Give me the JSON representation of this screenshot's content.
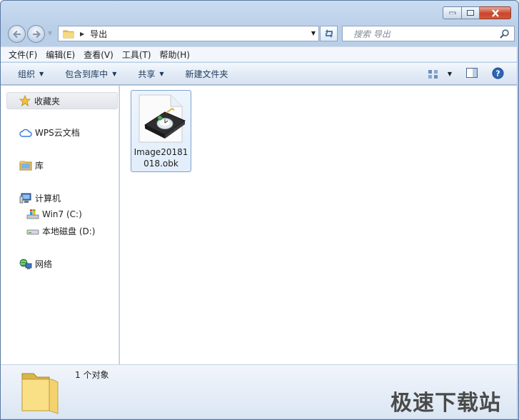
{
  "titlebar": {
    "minimize_icon": "minimize-icon",
    "maximize_icon": "maximize-icon",
    "close_icon": "close-icon"
  },
  "address_bar": {
    "breadcrumb": [
      "导出"
    ],
    "search_placeholder": "搜索 导出"
  },
  "menu": [
    {
      "label": "文件(F)"
    },
    {
      "label": "编辑(E)"
    },
    {
      "label": "查看(V)"
    },
    {
      "label": "工具(T)"
    },
    {
      "label": "帮助(H)"
    }
  ],
  "toolbar": {
    "organize": "组织",
    "include_in_library": "包含到库中",
    "share": "共享",
    "new_folder": "新建文件夹"
  },
  "nav": {
    "favorites": "收藏夹",
    "wps_cloud": "WPS云文档",
    "libraries": "库",
    "computer": "计算机",
    "drive_c": "Win7 (C:)",
    "drive_d": "本地磁盘 (D:)",
    "network": "网络"
  },
  "files": [
    {
      "name": "Image20181018.obk",
      "icon": "obk-file-icon"
    }
  ],
  "details": {
    "count": "1 个对象"
  },
  "watermark": "极速下载站",
  "colors": {
    "window_frame": "#b9cfe8",
    "selection": "#7da2ce",
    "close_button": "#c8452c"
  }
}
